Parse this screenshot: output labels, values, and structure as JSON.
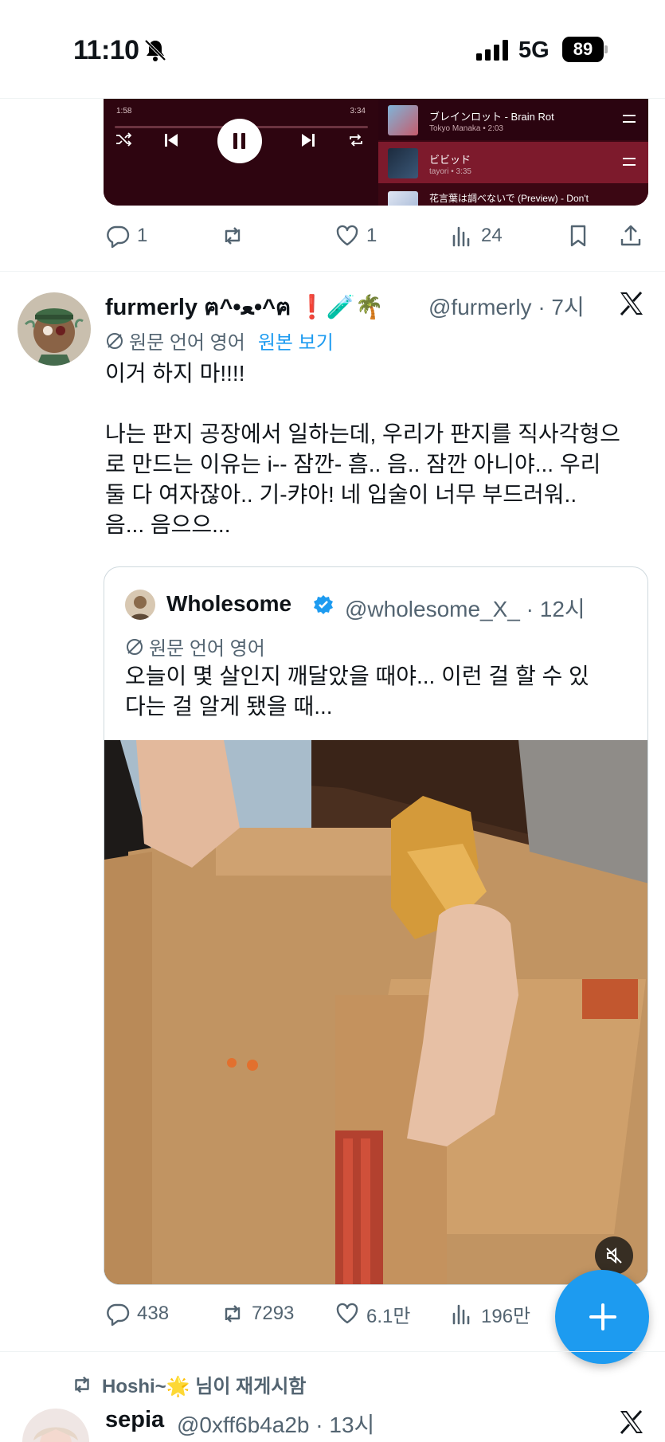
{
  "status_bar": {
    "time": "11:10",
    "network": "5G",
    "battery": "89"
  },
  "music_player": {
    "elapsed": "1:58",
    "duration": "3:34",
    "tracks": [
      {
        "title": "ブレインロット - Brain Rot",
        "subtitle": "Tokyo Manaka • 2:03"
      },
      {
        "title": "ビビッド",
        "subtitle": "tayori • 3:35"
      },
      {
        "title": "花言葉は調べないで (Preview) - Don't",
        "subtitle": ""
      }
    ]
  },
  "prev_tweet": {
    "replies": "1",
    "reposts": "",
    "likes": "1",
    "views": "24"
  },
  "tweet": {
    "name": "furmerly ฅ^•ﻌ•^ฅ ❗🧪🌴",
    "handle": "@furmerly · 7시",
    "translation_note": "원문 언어 영어",
    "show_original": "원본 보기",
    "text": "이거 하지 마!!!!\n\n나는 판지 공장에서 일하는데, 우리가 판지를 직사각형으\n로 만드는 이유는 i-- 잠깐- 흠.. 음.. 잠깐 아니야... 우리\n둘 다 여자잖아.. 기-캬아! 네 입술이 너무 부드러워..\n음... 음으으...",
    "stats": {
      "replies": "438",
      "reposts": "7293",
      "likes": "6.1만",
      "views": "196만"
    }
  },
  "quoted": {
    "name": "Wholesome",
    "handle": "@wholesome_X_ · 12시",
    "translation_note": "원문 언어 영어",
    "text": "오늘이 몇 살인지 깨달았을 때야... 이런 걸 할 수 있\n다는 걸 알게 됐을 때..."
  },
  "next_tweet": {
    "repost_context": "Hoshi~🌟 님이 재게시함",
    "name": "sepia",
    "handle": "@0xff6b4a2b · 13시"
  },
  "colors": {
    "accent": "#1d9bf0",
    "muted": "#536471",
    "player_bg": "#3b0713"
  }
}
